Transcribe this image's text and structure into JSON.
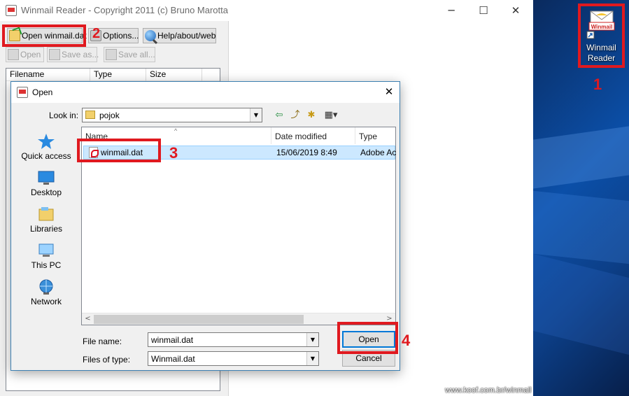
{
  "app": {
    "title": "Winmail Reader - Copyright 2011 (c) Bruno Marotta",
    "caption_minimize": "─",
    "caption_maximize": "☐",
    "caption_close": "✕",
    "toolbar": {
      "open_winmail": "Open winmail.dat",
      "options": "Options...",
      "help": "Help/about/web",
      "open": "Open",
      "save_as": "Save as...",
      "save_all": "Save all..."
    },
    "list_columns": [
      "Filename",
      "Type",
      "Size"
    ]
  },
  "dialog": {
    "title": "Open",
    "close": "✕",
    "look_in_label": "Look in:",
    "look_in_value": "pojok",
    "nav_back_icon": "back-arrow-icon",
    "nav_up_icon": "up-folder-icon",
    "nav_new_folder_icon": "new-folder-icon",
    "nav_view_icon": "view-menu-icon",
    "places": [
      "Quick access",
      "Desktop",
      "Libraries",
      "This PC",
      "Network"
    ],
    "columns": [
      "Name",
      "Date modified",
      "Type"
    ],
    "files": [
      {
        "name": "winmail.dat",
        "date": "15/06/2019 8:49",
        "type": "Adobe Ac"
      }
    ],
    "file_name_label": "File name:",
    "file_name_value": "winmail.dat",
    "files_of_type_label": "Files of type:",
    "files_of_type_value": "Winmail.dat",
    "open_button": "Open",
    "cancel_button": "Cancel"
  },
  "desktop": {
    "icon_label_line1": "Winmail",
    "icon_label_line2": "Reader",
    "icon_badge": "Winmail"
  },
  "annotations": {
    "step1": "1",
    "step2": "2",
    "step3": "3",
    "step4": "4",
    "color": "#e0191f"
  },
  "watermark": "www.koof.com.br/winmail"
}
